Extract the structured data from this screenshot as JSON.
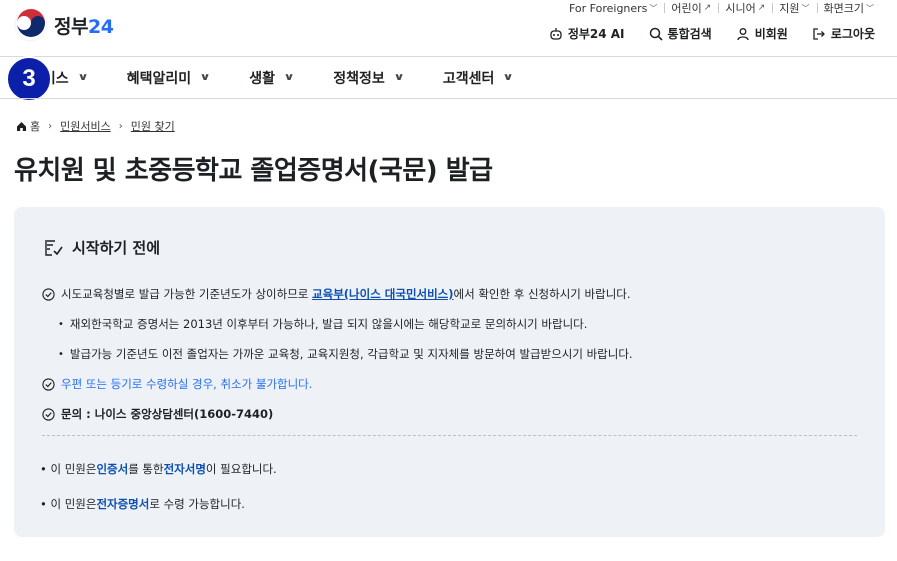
{
  "logo": {
    "text_main": "정부",
    "text_num": "24"
  },
  "utility": [
    {
      "label": "For Foreigners",
      "suffix": "caret"
    },
    {
      "label": "어린이",
      "suffix": "ext"
    },
    {
      "label": "시니어",
      "suffix": "ext"
    },
    {
      "label": "지원",
      "suffix": "caret"
    },
    {
      "label": "화면크기",
      "suffix": "caret"
    }
  ],
  "actions": {
    "ai": "정부24 AI",
    "search": "통합검색",
    "member": "비회원",
    "logout": "로그아웃"
  },
  "nav": [
    "서비스",
    "혜택알리미",
    "생활",
    "정책정보",
    "고객센터"
  ],
  "badge": "3",
  "breadcrumb": {
    "home": "홈",
    "level1": "민원서비스",
    "level2": "민원 찾기"
  },
  "page_title": "유치원 및 초중등학교 졸업증명서(국문) 발급",
  "panel": {
    "heading": "시작하기 전에",
    "item1_pre": "시도교육청별로 발급 가능한 기준년도가 상이하므로 ",
    "item1_link": "교육부(나이스 대국민서비스)",
    "item1_post": "에서 확인한 후 신청하시기 바랍니다.",
    "sub1": "재외한국학교 증명서는 2013년 이후부터 가능하나, 발급 되지 않을시에는 해당학교로 문의하시기 바랍니다.",
    "sub2": "발급가능 기준년도 이전 졸업자는 가까운 교육청, 교육지원청, 각급학교 및 지자체를 방문하여 발급받으시기 바랍니다.",
    "item2": "우편 또는 등기로 수령하실 경우, 취소가 불가합니다.",
    "item3": "문의 : 나이스 중앙상담센터(1600-7440)",
    "note1_pre": "이 민원은 ",
    "note1_b1": "인증서",
    "note1_mid": "를 통한 ",
    "note1_b2": "전자서명",
    "note1_post": "이 필요합니다.",
    "note2_pre": "이 민원은 ",
    "note2_b": "전자증명서",
    "note2_post": "로 수령 가능합니다."
  }
}
